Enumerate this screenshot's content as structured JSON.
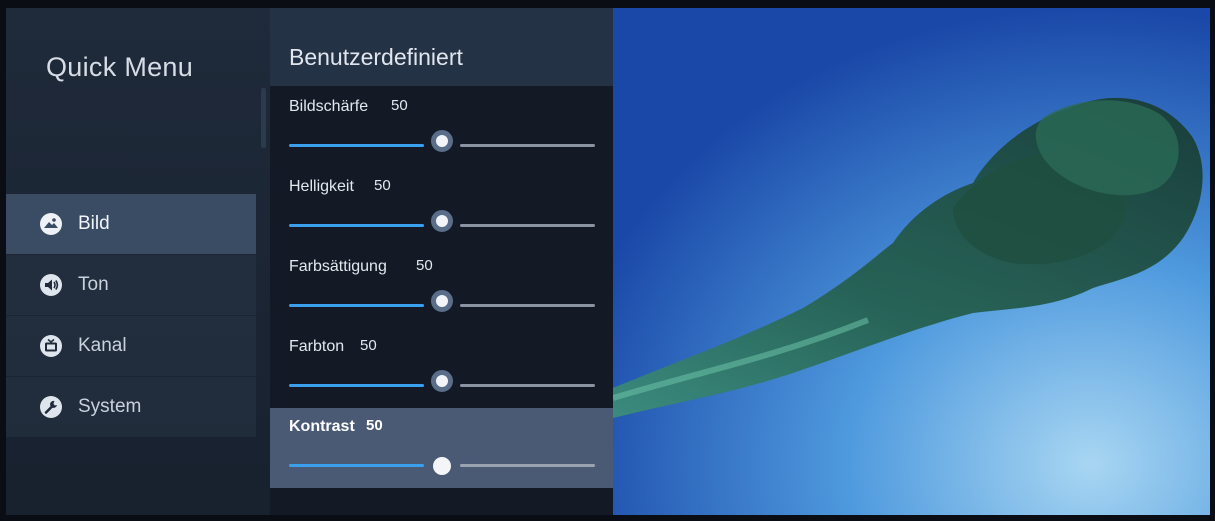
{
  "quick_menu": {
    "title": "Quick Menu",
    "items": [
      {
        "label": "Bild",
        "icon": "picture-icon",
        "active": true
      },
      {
        "label": "Ton",
        "icon": "speaker-icon",
        "active": false
      },
      {
        "label": "Kanal",
        "icon": "tv-icon",
        "active": false
      },
      {
        "label": "System",
        "icon": "wrench-icon",
        "active": false
      }
    ]
  },
  "panel": {
    "title": "Benutzerdefiniert",
    "settings": [
      {
        "label": "Bildschärfe",
        "value": "50",
        "level": 0.5
      },
      {
        "label": "Helligkeit",
        "value": "50",
        "level": 0.5
      },
      {
        "label": "Farbsättigung",
        "value": "50",
        "level": 0.5
      },
      {
        "label": "Farbton",
        "value": "50",
        "level": 0.5
      },
      {
        "label": "Kontrast",
        "value": "50",
        "level": 0.5,
        "focused": true
      }
    ]
  },
  "colors": {
    "accent": "#3aa0ee",
    "menu_bg": "#1f2a3a",
    "active_item": "#3a4b64",
    "focused_row": "#4a5a74"
  }
}
